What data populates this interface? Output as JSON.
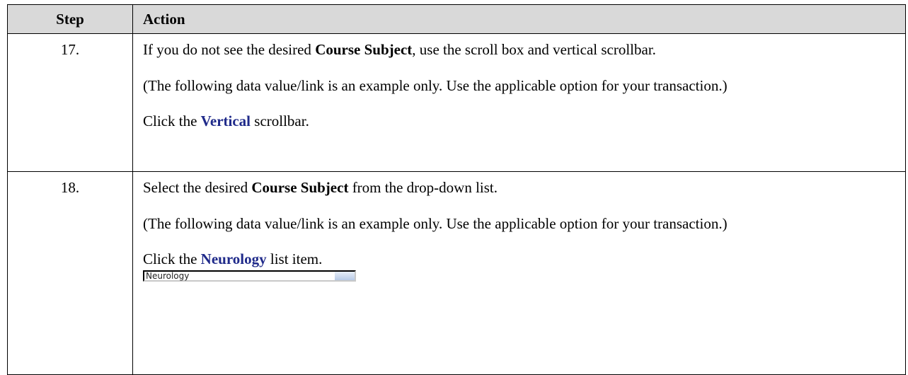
{
  "header": {
    "step_label": "Step",
    "action_label": "Action"
  },
  "steps": [
    {
      "number": "17.",
      "line1_pre": "If you do not see the desired ",
      "line1_bold": "Course Subject",
      "line1_post": ", use the scroll box and vertical scrollbar.",
      "note": "(The following data value/link is an example only.  Use the applicable option for your transaction.)",
      "click_pre": "Click the ",
      "click_link": "Vertical",
      "click_post": " scrollbar."
    },
    {
      "number": "18.",
      "line1_pre": "Select the desired ",
      "line1_bold": "Course Subject",
      "line1_post": " from the drop-down list.",
      "note": "(The following data value/link is an example only.  Use the applicable option for your transaction.)",
      "click_pre": "Click the ",
      "click_link": "Neurology",
      "click_post": " list item.",
      "list_item_text": "Neurology"
    }
  ]
}
